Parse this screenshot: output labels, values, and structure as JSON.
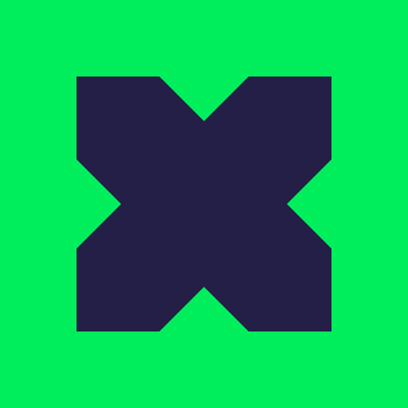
{
  "logo": {
    "icon": "x-mark-icon",
    "background_color": "#00ee5c",
    "mark_color": "#231f47"
  }
}
